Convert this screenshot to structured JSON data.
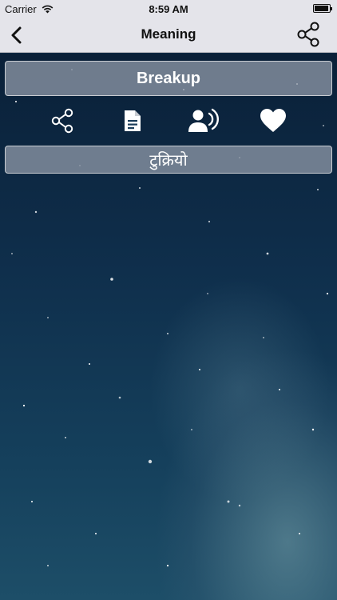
{
  "status_bar": {
    "carrier": "Carrier",
    "time": "8:59 AM"
  },
  "nav": {
    "title": "Meaning",
    "back_icon": "chevron-left-icon",
    "share_icon": "share-icon"
  },
  "word": "Breakup",
  "meaning": "टुक्रियो",
  "actions": [
    {
      "name": "share",
      "icon": "share-icon"
    },
    {
      "name": "copy",
      "icon": "document-icon"
    },
    {
      "name": "speak",
      "icon": "speaker-person-icon"
    },
    {
      "name": "favorite",
      "icon": "heart-icon"
    }
  ],
  "colors": {
    "bar": "#e4e4ea",
    "box_fill": "#8c96a5",
    "background_top": "#0a2038",
    "background_bottom": "#1d4e68"
  }
}
